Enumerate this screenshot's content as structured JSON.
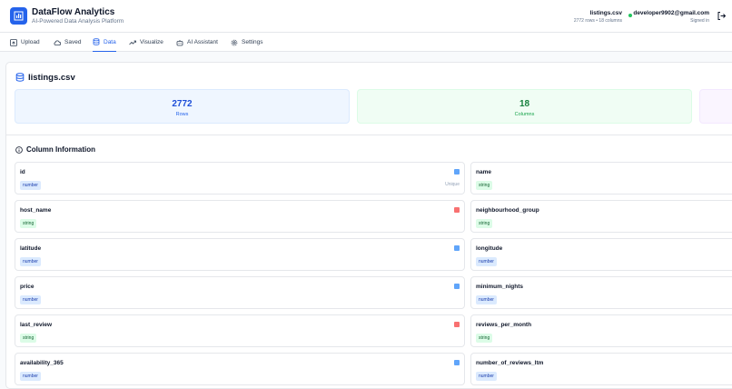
{
  "app": {
    "title": "DataFlow Analytics",
    "subtitle": "AI-Powered Data Analysis Platform"
  },
  "file_info": {
    "name": "listings.csv",
    "meta": "2772 rows • 18 columns"
  },
  "user": {
    "email": "developer9902@gmail.com",
    "status": "Signed in"
  },
  "tabs": [
    {
      "label": "Upload",
      "icon": "upload-icon"
    },
    {
      "label": "Saved",
      "icon": "cloud-icon"
    },
    {
      "label": "Data",
      "icon": "database-icon",
      "active": true
    },
    {
      "label": "Visualize",
      "icon": "trend-icon"
    },
    {
      "label": "AI Assistant",
      "icon": "bot-icon"
    },
    {
      "label": "Settings",
      "icon": "gear-icon"
    }
  ],
  "dataset": {
    "title": "listings.csv",
    "stats": [
      {
        "value": "2772",
        "label": "Rows"
      },
      {
        "value": "18",
        "label": "Columns"
      }
    ]
  },
  "column_section": {
    "title": "Column Information"
  },
  "columns": [
    {
      "name": "id",
      "type": "number",
      "unique": "Unique"
    },
    {
      "name": "name",
      "type": "string"
    },
    {
      "name": "host_name",
      "type": "string"
    },
    {
      "name": "neighbourhood_group",
      "type": "string"
    },
    {
      "name": "latitude",
      "type": "number"
    },
    {
      "name": "longitude",
      "type": "number"
    },
    {
      "name": "price",
      "type": "number"
    },
    {
      "name": "minimum_nights",
      "type": "number"
    },
    {
      "name": "last_review",
      "type": "string"
    },
    {
      "name": "reviews_per_month",
      "type": "string"
    },
    {
      "name": "availability_365",
      "type": "number"
    },
    {
      "name": "number_of_reviews_ltm",
      "type": "number"
    }
  ],
  "colors": {
    "accent": "#2563eb",
    "rows_bg": "#eff6ff",
    "rows_text": "#1d4ed8",
    "cols_bg": "#f0fdf4",
    "cols_text": "#15803d",
    "online": "#22c55e"
  }
}
